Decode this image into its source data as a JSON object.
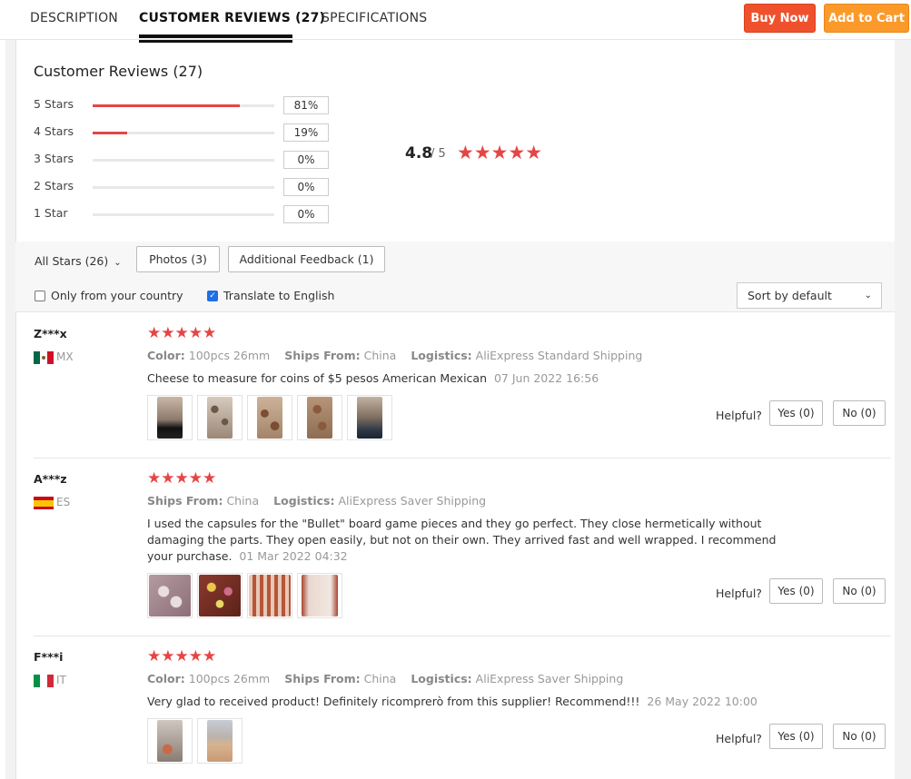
{
  "tabs": [
    {
      "label": "DESCRIPTION"
    },
    {
      "label": "CUSTOMER REVIEWS (27)"
    },
    {
      "label": "SPECIFICATIONS"
    }
  ],
  "actions": {
    "buy_now": "Buy Now",
    "add_to_cart": "Add to Cart"
  },
  "summary": {
    "title": "Customer Reviews (27)",
    "rows": [
      {
        "label": "5 Stars",
        "percent": "81%",
        "fraction": 0.81
      },
      {
        "label": "4 Stars",
        "percent": "19%",
        "fraction": 0.19
      },
      {
        "label": "3 Stars",
        "percent": "0%",
        "fraction": 0
      },
      {
        "label": "2 Stars",
        "percent": "0%",
        "fraction": 0
      },
      {
        "label": "1 Star",
        "percent": "0%",
        "fraction": 0
      }
    ],
    "average": "4.8",
    "out_of": "/ 5",
    "stars": "★★★★★"
  },
  "filters": {
    "all_stars": "All Stars (26)",
    "photos": "Photos (3)",
    "additional": "Additional Feedback (1)",
    "only_country": "Only from your country",
    "translate": "Translate to English",
    "sort": "Sort by default"
  },
  "reviews": [
    {
      "name": "Z***x",
      "country": "MX",
      "stars": "★★★★★",
      "color_label": "Color:",
      "color": "100pcs 26mm",
      "ships_label": "Ships From:",
      "ships": "China",
      "logistics_label": "Logistics:",
      "logistics": "AliExpress Standard Shipping",
      "text": "Cheese to measure for coins of $5 pesos American Mexican",
      "date": "07 Jun 2022 16:56",
      "helpful": "Helpful?",
      "yes": "Yes (0)",
      "no": "No (0)"
    },
    {
      "name": "A***z",
      "country": "ES",
      "stars": "★★★★★",
      "ships_label": "Ships From:",
      "ships": "China",
      "logistics_label": "Logistics:",
      "logistics": "AliExpress Saver Shipping",
      "text": "I used the capsules for the \"Bullet\" board game pieces and they go perfect. They close hermetically without damaging the parts. They open easily, but not on their own. They arrived fast and well wrapped. I recommend your purchase.",
      "date": "01 Mar 2022 04:32",
      "helpful": "Helpful?",
      "yes": "Yes (0)",
      "no": "No (0)"
    },
    {
      "name": "F***i",
      "country": "IT",
      "stars": "★★★★★",
      "color_label": "Color:",
      "color": "100pcs 26mm",
      "ships_label": "Ships From:",
      "ships": "China",
      "logistics_label": "Logistics:",
      "logistics": "AliExpress Saver Shipping",
      "text": "Very glad to received product! Definitely ricomprerò from this supplier! Recommend!!!",
      "date": "26 May 2022 10:00",
      "helpful": "Helpful?",
      "yes": "Yes (0)",
      "no": "No (0)"
    }
  ],
  "colors": {
    "accent_red": "#e64545",
    "buy": "#f0512d",
    "cart": "#fb9a2a",
    "check": "#1f6fe5"
  }
}
